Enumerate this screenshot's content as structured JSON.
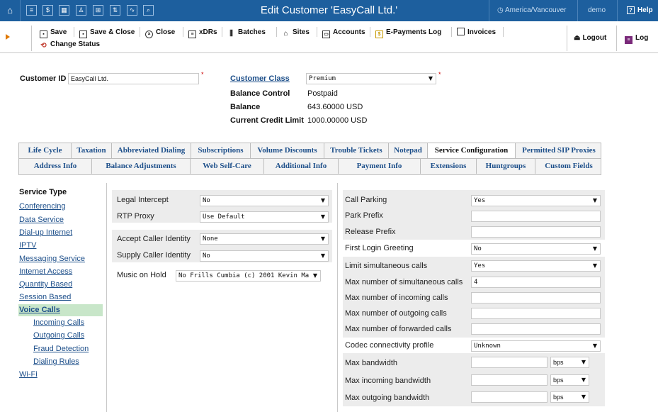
{
  "topbar": {
    "title": "Edit Customer 'EasyCall Ltd.'",
    "timezone": "America/Vancouver",
    "user": "demo",
    "help": "Help",
    "accent": "#1d5f9e"
  },
  "toolbar": {
    "save": "Save",
    "save_close": "Save & Close",
    "close": "Close",
    "xdrs": "xDRs",
    "batches": "Batches",
    "sites": "Sites",
    "accounts": "Accounts",
    "epayments": "E-Payments Log",
    "invoices": "Invoices",
    "change_status": "Change Status",
    "logout": "Logout",
    "log": "Log"
  },
  "customer": {
    "id_label": "Customer ID",
    "id_value": "EasyCall Ltd.",
    "class_label": "Customer Class",
    "class_value": "Premium",
    "balance_control_label": "Balance Control",
    "balance_control_value": "Postpaid",
    "balance_label": "Balance",
    "balance_value": "643.60000 USD",
    "credit_limit_label": "Current Credit Limit",
    "credit_limit_value": "1000.00000 USD"
  },
  "tabs_row1": [
    "Life Cycle",
    "Taxation",
    "Abbreviated Dialing",
    "Subscriptions",
    "Volume Discounts",
    "Trouble Tickets",
    "Notepad",
    "Service Configuration",
    "Permitted SIP Proxies"
  ],
  "tabs_row2": [
    "Address Info",
    "Balance Adjustments",
    "Web Self-Care",
    "Additional Info",
    "Payment Info",
    "Extensions",
    "Huntgroups",
    "Custom Fields"
  ],
  "sidebar": {
    "heading": "Service Type",
    "items": [
      "Conferencing",
      "Data Service",
      "Dial-up Internet",
      "IPTV",
      "Messaging Service",
      "Internet Access",
      "Quantity Based",
      "Session Based",
      "Voice Calls"
    ],
    "subitems": [
      "Incoming Calls",
      "Outgoing Calls",
      "Fraud Detection",
      "Dialing Rules"
    ],
    "last": "Wi-Fi"
  },
  "left_fields": {
    "legal_intercept": {
      "label": "Legal Intercept",
      "value": "No"
    },
    "rtp_proxy": {
      "label": "RTP Proxy",
      "value": "Use Default"
    },
    "accept_caller": {
      "label": "Accept Caller Identity",
      "value": "None"
    },
    "supply_caller": {
      "label": "Supply Caller Identity",
      "value": "No"
    },
    "music_on_hold": {
      "label": "Music on Hold",
      "value": "No Frills Cumbia (c) 2001 Kevin Ma"
    }
  },
  "right_fields": {
    "call_parking": {
      "label": "Call Parking",
      "value": "Yes"
    },
    "park_prefix": {
      "label": "Park Prefix",
      "value": ""
    },
    "release_prefix": {
      "label": "Release Prefix",
      "value": ""
    },
    "first_login": {
      "label": "First Login Greeting",
      "value": "No"
    },
    "limit_calls": {
      "label": "Limit simultaneous calls",
      "value": "Yes"
    },
    "max_sim": {
      "label": "Max number of simultaneous calls",
      "value": "4"
    },
    "max_in": {
      "label": "Max number of incoming calls",
      "value": ""
    },
    "max_out": {
      "label": "Max number of outgoing calls",
      "value": ""
    },
    "max_fwd": {
      "label": "Max number of forwarded calls",
      "value": ""
    },
    "codec": {
      "label": "Codec connectivity profile",
      "value": "Unknown"
    },
    "max_bw": {
      "label": "Max bandwidth",
      "value": "",
      "unit": "bps"
    },
    "max_in_bw": {
      "label": "Max incoming bandwidth",
      "value": "",
      "unit": "bps"
    },
    "max_out_bw": {
      "label": "Max outgoing bandwidth",
      "value": "",
      "unit": "bps"
    }
  }
}
